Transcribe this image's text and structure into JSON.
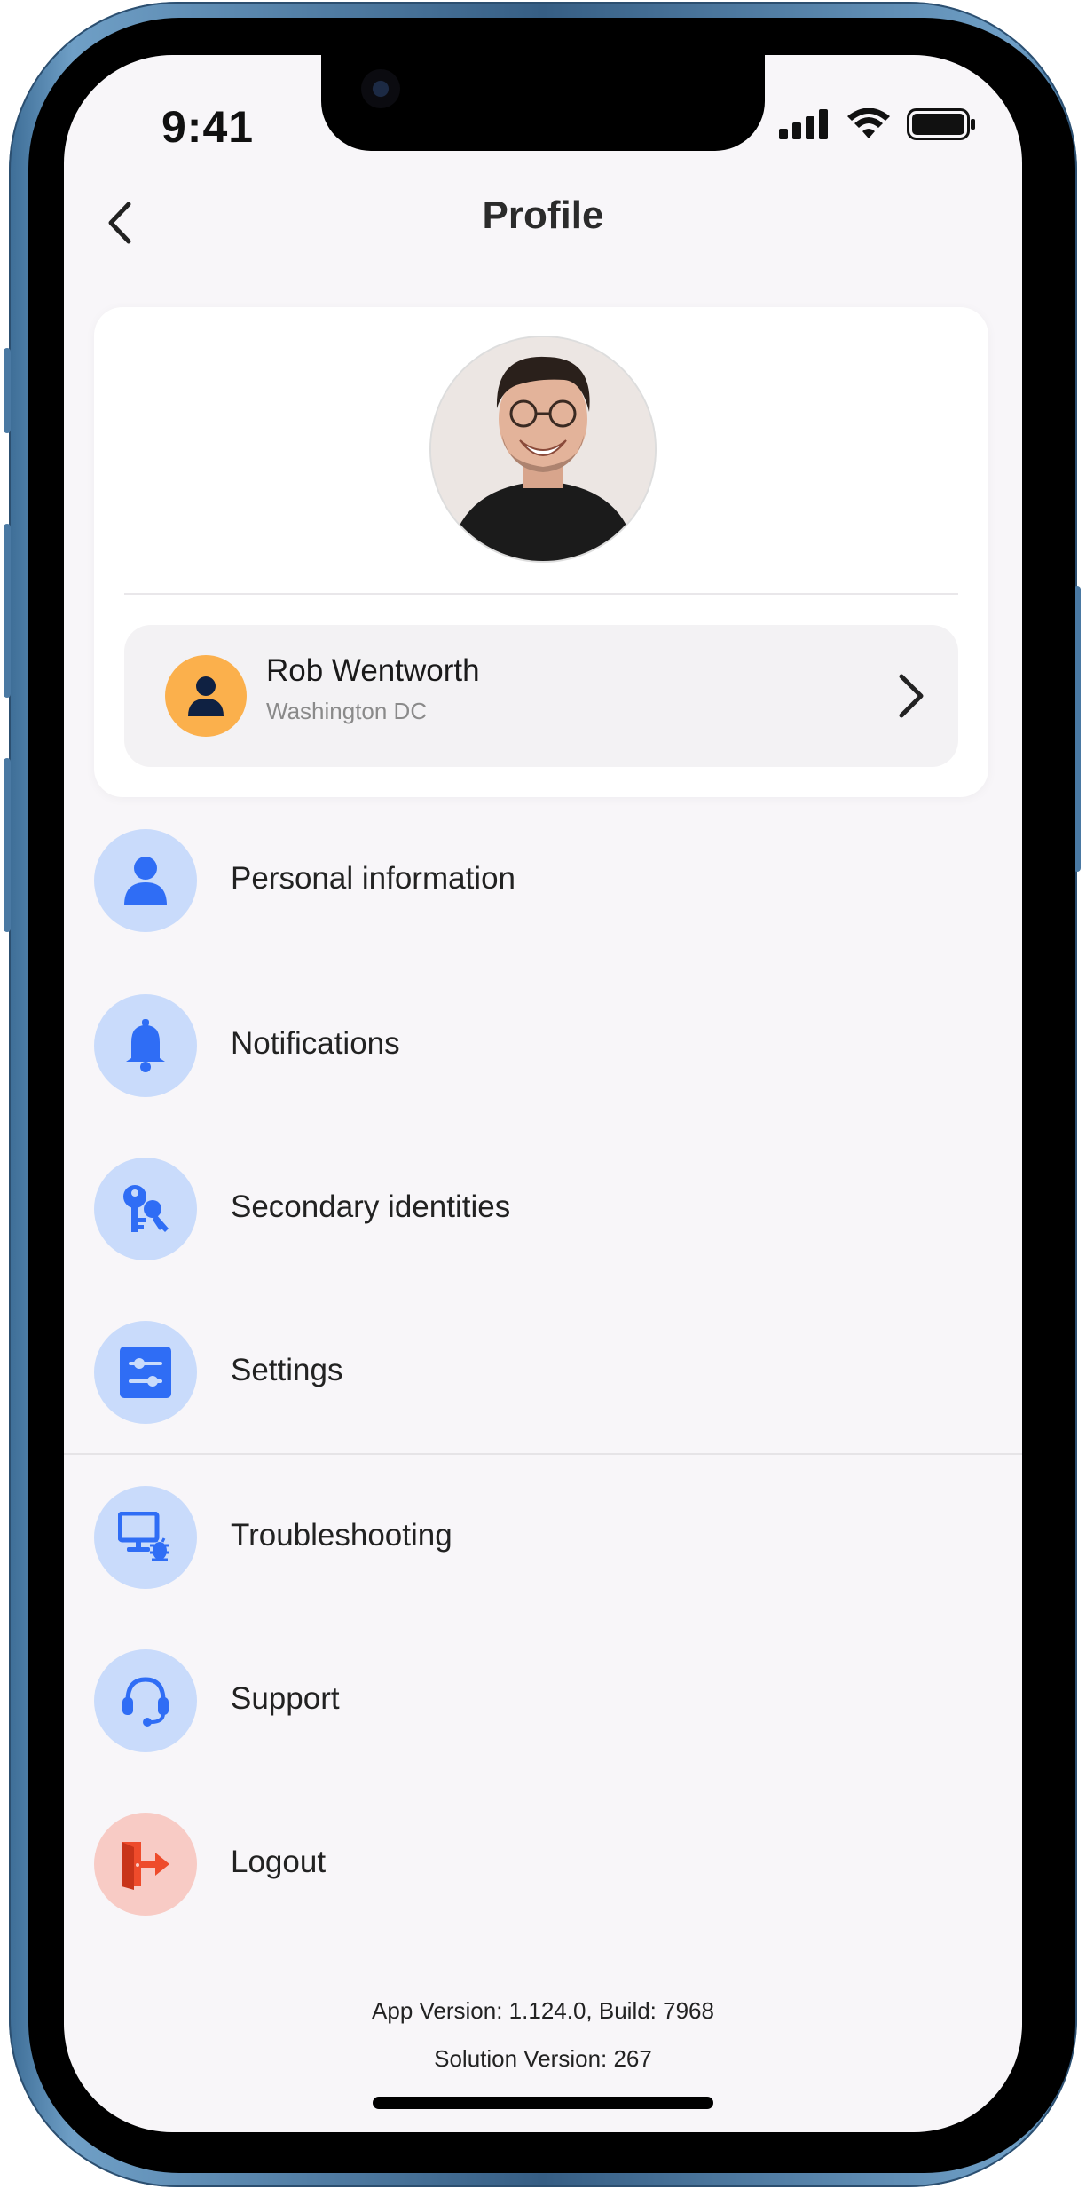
{
  "status_bar": {
    "time": "9:41",
    "icons": [
      "signal-icon",
      "wifi-icon",
      "battery-icon"
    ]
  },
  "header": {
    "title": "Profile",
    "back_icon": "chevron-left-icon"
  },
  "profile": {
    "name": "Rob Wentworth",
    "location": "Washington DC",
    "avatar_icon": "person-icon",
    "photo_icon": "profile-photo",
    "chevron_icon": "chevron-right-icon"
  },
  "menu": [
    {
      "label": "Personal information",
      "icon": "person-icon"
    },
    {
      "label": "Notifications",
      "icon": "bell-icon"
    },
    {
      "label": "Secondary identities",
      "icon": "keys-icon"
    },
    {
      "label": "Settings",
      "icon": "sliders-icon"
    },
    {
      "label": "Troubleshooting",
      "icon": "monitor-bug-icon"
    },
    {
      "label": "Support",
      "icon": "headset-icon"
    },
    {
      "label": "Logout",
      "icon": "logout-door-icon"
    }
  ],
  "footer": {
    "app_version": "App Version: 1.124.0, Build: 7968",
    "solution_version": "Solution Version: 267"
  },
  "colors": {
    "accent_blue": "#2f6df5",
    "icon_bg_blue": "#c9dbfb",
    "logout_red": "#ee4b2b",
    "logout_bg": "#f8cbc5",
    "avatar_orange": "#fbb04c",
    "screen_bg": "#f8f6f9"
  }
}
